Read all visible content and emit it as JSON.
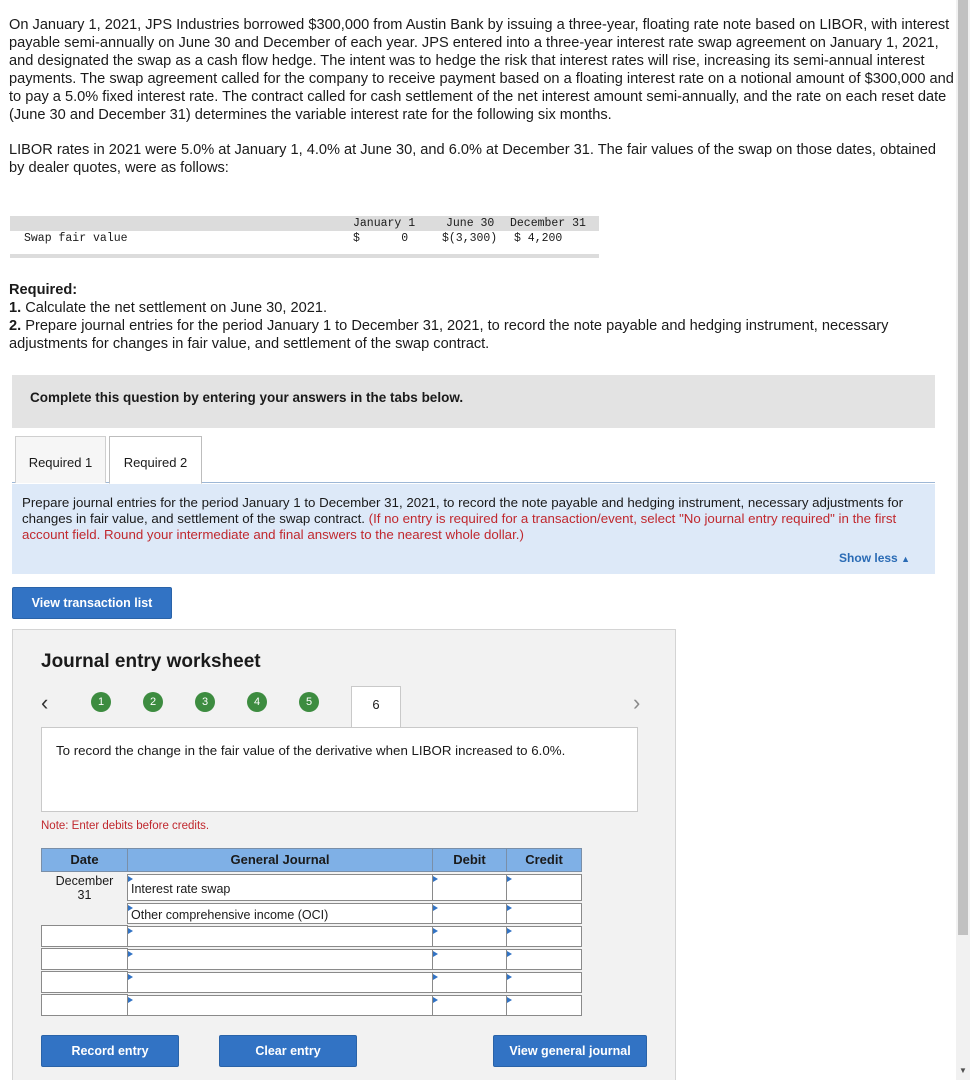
{
  "problem": {
    "para1": "On January 1, 2021, JPS Industries borrowed $300,000 from Austin Bank by issuing a three-year, floating rate note based on LIBOR, with interest payable semi-annually on June 30 and December of each year. JPS entered into a three-year interest rate swap agreement on January 1, 2021, and designated the swap as a cash flow hedge. The intent was to hedge the risk that interest rates will rise, increasing its semi-annual interest payments. The swap agreement called for the company to receive payment based on a floating interest rate on a notional amount of $300,000 and to pay a 5.0% fixed interest rate. The contract called for cash settlement of the net interest amount semi-annually, and the rate on each reset date (June 30 and December 31) determines the variable interest rate for the following six months.",
    "para2": "LIBOR rates in 2021 were 5.0% at January 1, 4.0% at June 30, and 6.0% at December 31. The fair values of the swap on those dates, obtained by dealer quotes, were as follows:"
  },
  "fair_value_table": {
    "row_label": "Swap fair value",
    "headers": [
      "January 1",
      "June 30",
      "December 31"
    ],
    "values": [
      "$      0",
      "$(3,300)",
      "$ 4,200"
    ]
  },
  "required": {
    "heading": "Required:",
    "item1_num": "1.",
    "item1_text": " Calculate the net settlement on June 30, 2021.",
    "item2_num": "2.",
    "item2_text": " Prepare journal entries for the period January 1 to December 31, 2021, to record the note payable and hedging instrument, necessary adjustments for changes in fair value, and settlement of the swap contract."
  },
  "complete_prompt": "Complete this question by entering your answers in the tabs below.",
  "tabs": [
    {
      "label": "Required 1"
    },
    {
      "label": "Required 2"
    }
  ],
  "instructions": {
    "text": "Prepare journal entries for the period January 1 to December 31, 2021, to record the note payable and hedging instrument, necessary adjustments for changes in fair value, and settlement of the swap contract. ",
    "red_text": "(If no entry is required for a transaction/event, select \"No journal entry required\" in the first account field. Round your intermediate and final answers to the nearest whole dollar.)",
    "show_less": "Show less"
  },
  "view_transaction_list": "View transaction list",
  "worksheet": {
    "title": "Journal entry worksheet",
    "steps": [
      "1",
      "2",
      "3",
      "4",
      "5"
    ],
    "current_step": "6",
    "description": "To record the change in the fair value of the derivative when LIBOR increased to 6.0%.",
    "note": "Note: Enter debits before credits.",
    "table": {
      "headers": {
        "date": "Date",
        "account": "General Journal",
        "debit": "Debit",
        "credit": "Credit"
      },
      "date_value": "December\n31",
      "date_line1": "December",
      "date_line2": "31",
      "rows": [
        {
          "account": "Interest rate swap",
          "debit": "",
          "credit": ""
        },
        {
          "account": "Other comprehensive income (OCI)",
          "debit": "",
          "credit": ""
        },
        {
          "account": "",
          "debit": "",
          "credit": ""
        },
        {
          "account": "",
          "debit": "",
          "credit": ""
        },
        {
          "account": "",
          "debit": "",
          "credit": ""
        },
        {
          "account": "",
          "debit": "",
          "credit": ""
        }
      ]
    },
    "buttons": {
      "record": "Record entry",
      "clear": "Clear entry",
      "view_journal": "View general journal"
    }
  },
  "colors": {
    "accent_blue": "#3273c4",
    "step_green": "#3d8c40",
    "header_blue": "#7fb0e6",
    "instruction_red": "#c0282e"
  }
}
